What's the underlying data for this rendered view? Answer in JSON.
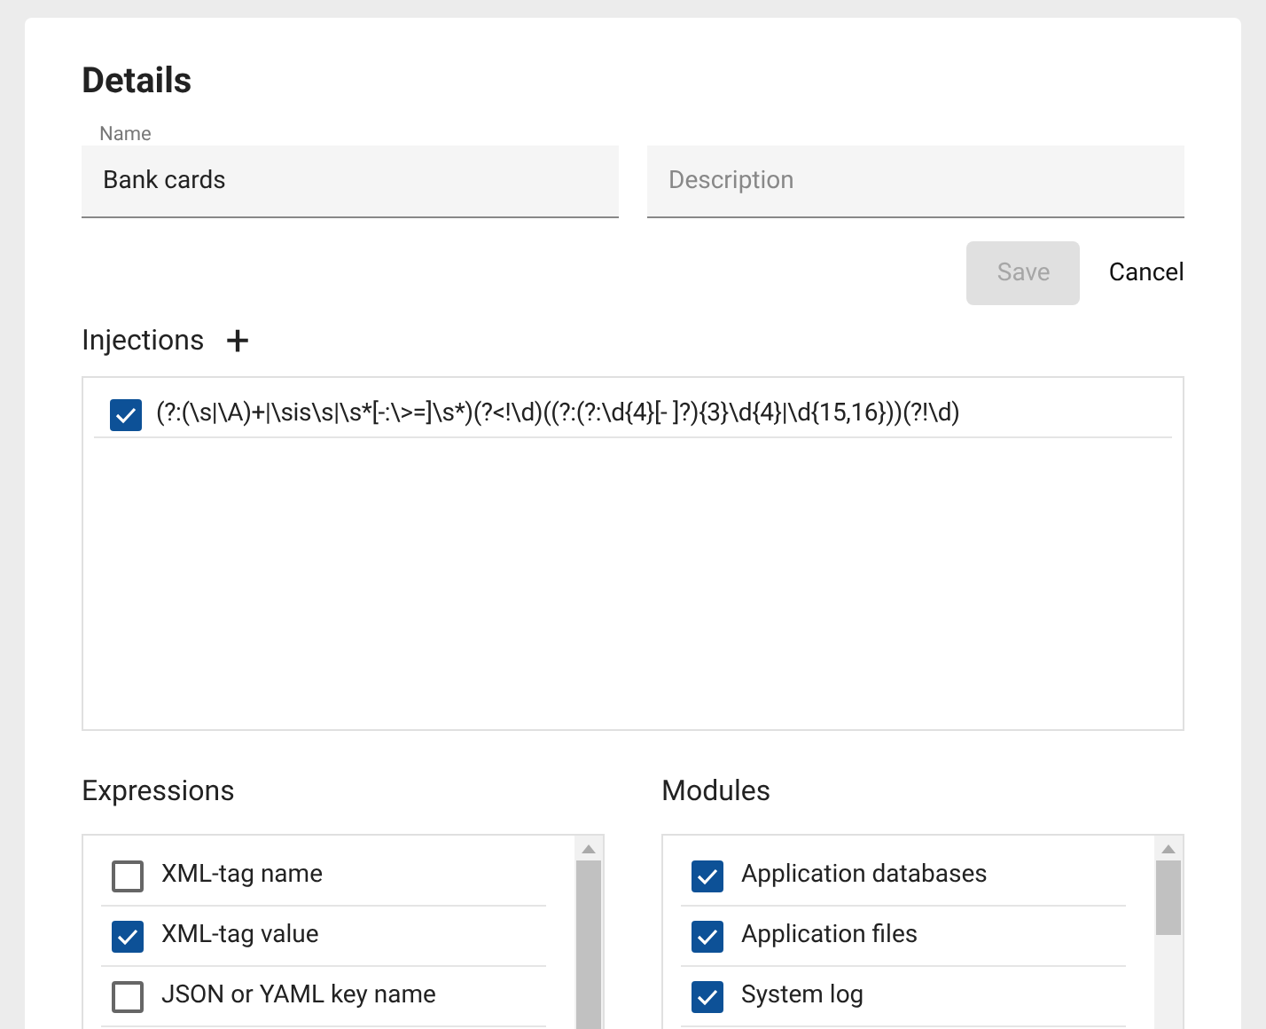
{
  "title": "Details",
  "name_field": {
    "label": "Name",
    "value": "Bank cards"
  },
  "description_field": {
    "placeholder": "Description"
  },
  "save_button": {
    "label": "Save",
    "disabled": true
  },
  "cancel_button": {
    "label": "Cancel"
  },
  "injections": {
    "title": "Injections",
    "add_icon": "+",
    "items": [
      {
        "text": "(?:(\\s|\\A)+|\\sis\\s|\\s*[-:\\>=]\\s*)(?<!\\d)((?:(?:\\d{4}[- ]?){3}\\d{4}|\\d{15,16}))(?!\\d)",
        "checked": true
      }
    ]
  },
  "expressions": {
    "title": "Expressions",
    "items": [
      {
        "label": "XML-tag name",
        "checked": false
      },
      {
        "label": "XML-tag value",
        "checked": true
      },
      {
        "label": "JSON or YAML key name",
        "checked": false
      }
    ]
  },
  "modules": {
    "title": "Modules",
    "items": [
      {
        "label": "Application databases",
        "checked": true
      },
      {
        "label": "Application files",
        "checked": true
      },
      {
        "label": "System log",
        "checked": true
      }
    ]
  }
}
